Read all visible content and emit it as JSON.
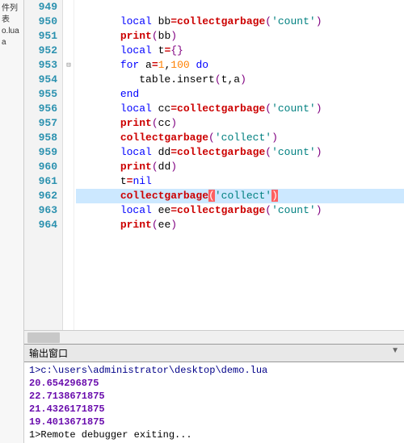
{
  "sidebar": {
    "items": [
      "件列表",
      "o.lua",
      "a"
    ]
  },
  "editor": {
    "lines": [
      {
        "num": "949",
        "tokens": []
      },
      {
        "num": "950",
        "tokens": [
          {
            "t": "local ",
            "c": "k-blue"
          },
          {
            "t": "bb",
            "c": ""
          },
          {
            "t": "=",
            "c": "k-red"
          },
          {
            "t": "collectgarbage",
            "c": "k-red"
          },
          {
            "t": "(",
            "c": "k-purple"
          },
          {
            "t": "'count'",
            "c": "k-str"
          },
          {
            "t": ")",
            "c": "k-purple"
          }
        ]
      },
      {
        "num": "951",
        "tokens": [
          {
            "t": "print",
            "c": "k-red"
          },
          {
            "t": "(",
            "c": "k-purple"
          },
          {
            "t": "bb",
            "c": ""
          },
          {
            "t": ")",
            "c": "k-purple"
          }
        ]
      },
      {
        "num": "952",
        "tokens": [
          {
            "t": "local ",
            "c": "k-blue"
          },
          {
            "t": "t",
            "c": ""
          },
          {
            "t": "=",
            "c": "k-red"
          },
          {
            "t": "{}",
            "c": "k-purple"
          }
        ]
      },
      {
        "num": "953",
        "fold": "⊟",
        "tokens": [
          {
            "t": "for ",
            "c": "k-blue"
          },
          {
            "t": "a",
            "c": ""
          },
          {
            "t": "=",
            "c": "k-red"
          },
          {
            "t": "1",
            "c": "k-num"
          },
          {
            "t": ",",
            "c": ""
          },
          {
            "t": "100",
            "c": "k-num"
          },
          {
            "t": " do",
            "c": "k-blue"
          }
        ]
      },
      {
        "num": "954",
        "indent": 1,
        "tokens": [
          {
            "t": "table.insert",
            "c": ""
          },
          {
            "t": "(",
            "c": "k-purple"
          },
          {
            "t": "t",
            "c": ""
          },
          {
            "t": ",",
            "c": ""
          },
          {
            "t": "a",
            "c": ""
          },
          {
            "t": ")",
            "c": "k-purple"
          }
        ]
      },
      {
        "num": "955",
        "foldend": true,
        "tokens": [
          {
            "t": "end",
            "c": "k-blue"
          }
        ]
      },
      {
        "num": "956",
        "tokens": [
          {
            "t": "local ",
            "c": "k-blue"
          },
          {
            "t": "cc",
            "c": ""
          },
          {
            "t": "=",
            "c": "k-red"
          },
          {
            "t": "collectgarbage",
            "c": "k-red"
          },
          {
            "t": "(",
            "c": "k-purple"
          },
          {
            "t": "'count'",
            "c": "k-str"
          },
          {
            "t": ")",
            "c": "k-purple"
          }
        ]
      },
      {
        "num": "957",
        "tokens": [
          {
            "t": "print",
            "c": "k-red"
          },
          {
            "t": "(",
            "c": "k-purple"
          },
          {
            "t": "cc",
            "c": ""
          },
          {
            "t": ")",
            "c": "k-purple"
          }
        ]
      },
      {
        "num": "958",
        "tokens": [
          {
            "t": "collectgarbage",
            "c": "k-red"
          },
          {
            "t": "(",
            "c": "k-purple"
          },
          {
            "t": "'collect'",
            "c": "k-str"
          },
          {
            "t": ")",
            "c": "k-purple"
          }
        ]
      },
      {
        "num": "959",
        "tokens": [
          {
            "t": "local ",
            "c": "k-blue"
          },
          {
            "t": "dd",
            "c": ""
          },
          {
            "t": "=",
            "c": "k-red"
          },
          {
            "t": "collectgarbage",
            "c": "k-red"
          },
          {
            "t": "(",
            "c": "k-purple"
          },
          {
            "t": "'count'",
            "c": "k-str"
          },
          {
            "t": ")",
            "c": "k-purple"
          }
        ]
      },
      {
        "num": "960",
        "tokens": [
          {
            "t": "print",
            "c": "k-red"
          },
          {
            "t": "(",
            "c": "k-purple"
          },
          {
            "t": "dd",
            "c": ""
          },
          {
            "t": ")",
            "c": "k-purple"
          }
        ]
      },
      {
        "num": "961",
        "tokens": [
          {
            "t": "t",
            "c": ""
          },
          {
            "t": "=",
            "c": "k-red"
          },
          {
            "t": "nil",
            "c": "k-blue"
          }
        ]
      },
      {
        "num": "962",
        "highlighted": true,
        "tokens": [
          {
            "t": "collectgarbage",
            "c": "k-red"
          },
          {
            "t": "(",
            "c": "bracket-hl"
          },
          {
            "t": "'collect'",
            "c": "k-str"
          },
          {
            "t": ")",
            "c": "bracket-hl"
          }
        ]
      },
      {
        "num": "963",
        "tokens": [
          {
            "t": "local ",
            "c": "k-blue"
          },
          {
            "t": "ee",
            "c": ""
          },
          {
            "t": "=",
            "c": "k-red"
          },
          {
            "t": "collectgarbage",
            "c": "k-red"
          },
          {
            "t": "(",
            "c": "k-purple"
          },
          {
            "t": "'count'",
            "c": "k-str"
          },
          {
            "t": ")",
            "c": "k-purple"
          }
        ]
      },
      {
        "num": "964",
        "tokens": [
          {
            "t": "print",
            "c": "k-red"
          },
          {
            "t": "(",
            "c": "k-purple"
          },
          {
            "t": "ee",
            "c": ""
          },
          {
            "t": ")",
            "c": "k-purple"
          }
        ]
      }
    ]
  },
  "output": {
    "title": "输出窗口",
    "lines": [
      {
        "text": "1>c:\\users\\administrator\\desktop\\demo.lua",
        "cls": "out-path"
      },
      {
        "text": "20.654296875",
        "cls": "out-val"
      },
      {
        "text": "22.7138671875",
        "cls": "out-val"
      },
      {
        "text": "21.4326171875",
        "cls": "out-val"
      },
      {
        "text": "19.4013671875",
        "cls": "out-val"
      },
      {
        "text": "1>Remote debugger exiting...",
        "cls": "out-exit"
      }
    ]
  }
}
